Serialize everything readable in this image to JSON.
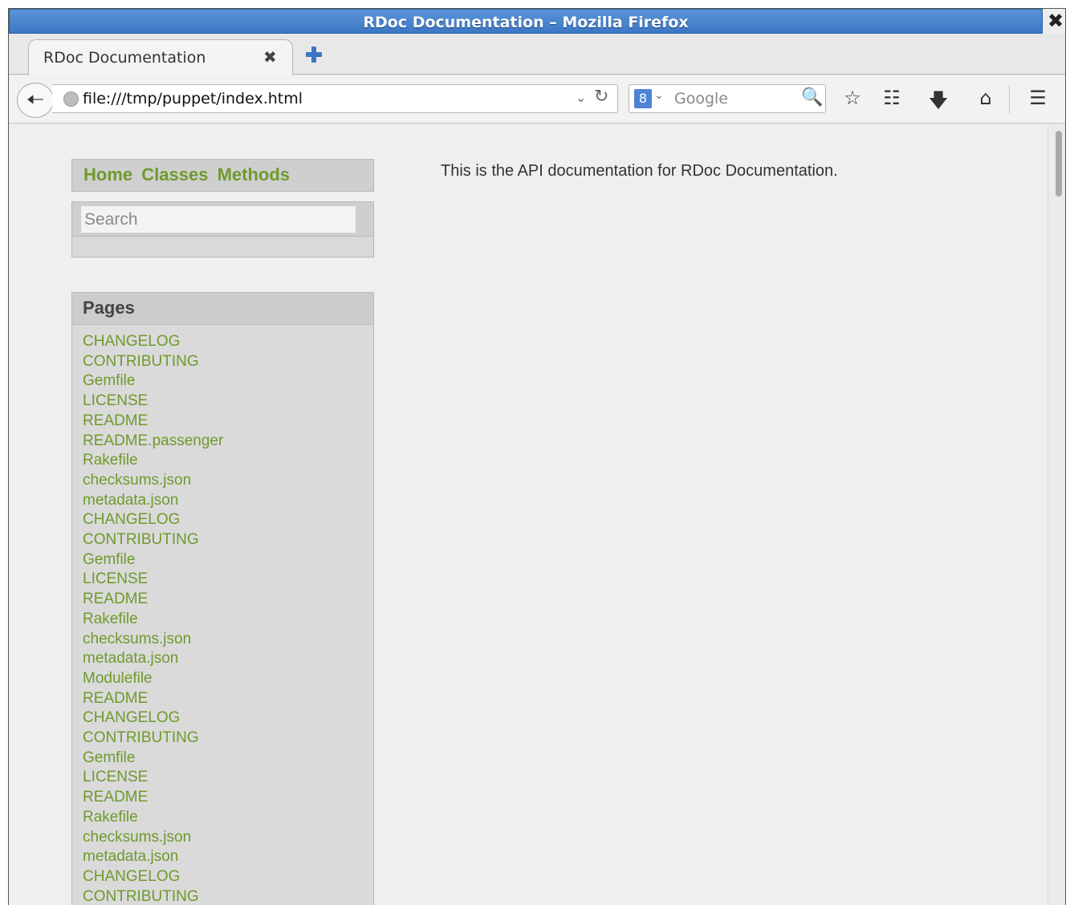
{
  "window": {
    "title": "RDoc Documentation – Mozilla Firefox",
    "close_glyph": "✖"
  },
  "tab": {
    "label": "RDoc Documentation",
    "close_glyph": "✖"
  },
  "navbar": {
    "back_glyph": "🠠",
    "url": "file:///tmp/puppet/index.html",
    "url_dropdown_glyph": "⌄",
    "reload_glyph": "↻",
    "search_engine_glyph": "8",
    "search_engine_drop_glyph": "⌄",
    "search_placeholder": "Google",
    "search_icon_glyph": "🔍",
    "bookmark_glyph": "☆",
    "reading_list_glyph": "☷",
    "download_glyph": "🡇",
    "home_glyph": "⌂",
    "menu_glyph": "☰"
  },
  "sidebar": {
    "nav_links": [
      "Home",
      "Classes",
      "Methods"
    ],
    "search_placeholder": "Search",
    "pages_title": "Pages",
    "pages": [
      "CHANGELOG",
      "CONTRIBUTING",
      "Gemfile",
      "LICENSE",
      "README",
      "README.passenger",
      "Rakefile",
      "checksums.json",
      "metadata.json",
      "CHANGELOG",
      "CONTRIBUTING",
      "Gemfile",
      "LICENSE",
      "README",
      "Rakefile",
      "checksums.json",
      "metadata.json",
      "Modulefile",
      "README",
      "CHANGELOG",
      "CONTRIBUTING",
      "Gemfile",
      "LICENSE",
      "README",
      "Rakefile",
      "checksums.json",
      "metadata.json",
      "CHANGELOG",
      "CONTRIBUTING"
    ]
  },
  "main": {
    "description": "This is the API documentation for RDoc Documentation."
  },
  "colors": {
    "link_green": "#6f9a2c",
    "titlebar_blue": "#3c78c4"
  }
}
